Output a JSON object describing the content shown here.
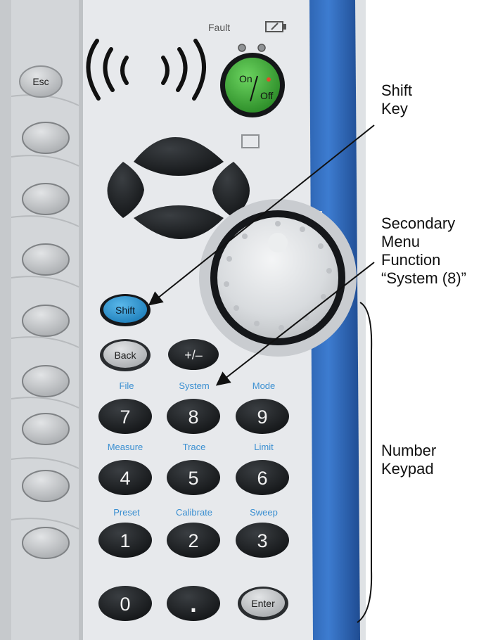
{
  "device": {
    "status": {
      "fault_label": "Fault"
    },
    "keys": {
      "esc": "Esc",
      "on": "On",
      "off": "Off",
      "shift": "Shift",
      "back": "Back",
      "plus_minus": "+/–",
      "enter": "Enter",
      "decimal": "."
    },
    "keypad": {
      "digits": [
        "7",
        "8",
        "9",
        "4",
        "5",
        "6",
        "1",
        "2",
        "3",
        "0"
      ],
      "secondary": [
        "File",
        "System",
        "Mode",
        "Measure",
        "Trace",
        "Limit",
        "Preset",
        "Calibrate",
        "Sweep"
      ]
    }
  },
  "callouts": {
    "shift_key": [
      "Shift",
      "Key"
    ],
    "secondary_menu": [
      "Secondary",
      "Menu",
      "Function",
      "“System (8)”"
    ],
    "number_keypad": [
      "Number",
      "Keypad"
    ]
  },
  "colors": {
    "panel": "#e3e6e9",
    "side_strip": "#d4d7da",
    "blue_frame": "#2d67b7",
    "dark_key": "#1c1f22",
    "light_key": "#c8cbcd",
    "shift_key": "#2a93cf",
    "power_green": "#3aa635",
    "secondary_label": "#3a8fd1"
  }
}
